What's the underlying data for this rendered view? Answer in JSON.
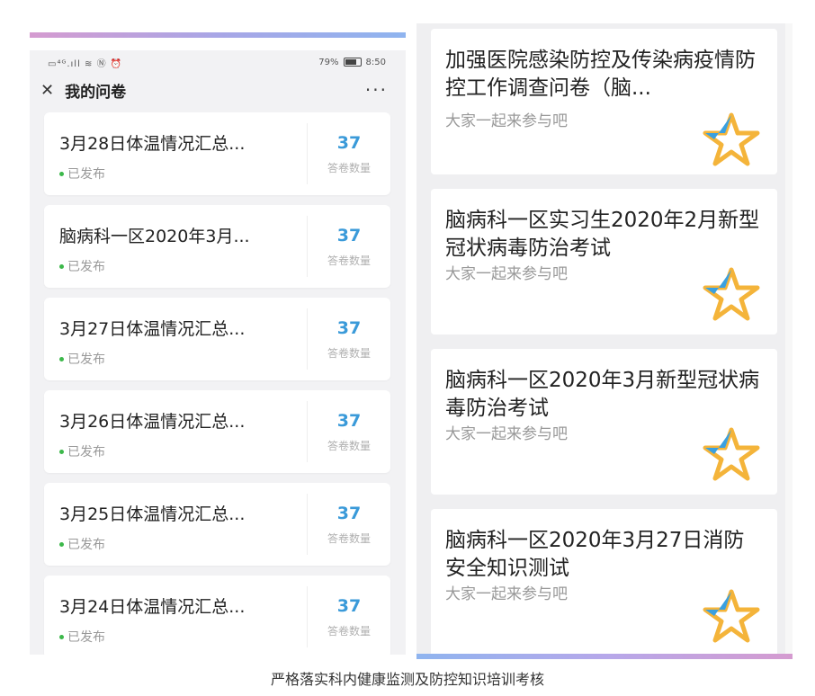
{
  "left_phone": {
    "statusbar": {
      "left_icons": "▭⁴ᴳ.ıll ≋ Ⓝ ⏰",
      "battery": "79%",
      "time": "8:50"
    },
    "title": "我的问卷",
    "more_label": "···",
    "cards": [
      {
        "title": "3月28日体温情况汇总...",
        "status": "已发布",
        "count": "37",
        "count_label": "答卷数量"
      },
      {
        "title": "脑病科一区2020年3月...",
        "status": "已发布",
        "count": "37",
        "count_label": "答卷数量"
      },
      {
        "title": "3月27日体温情况汇总...",
        "status": "已发布",
        "count": "37",
        "count_label": "答卷数量"
      },
      {
        "title": "3月26日体温情况汇总...",
        "status": "已发布",
        "count": "37",
        "count_label": "答卷数量"
      },
      {
        "title": "3月25日体温情况汇总...",
        "status": "已发布",
        "count": "37",
        "count_label": "答卷数量"
      },
      {
        "title": "3月24日体温情况汇总...",
        "status": "已发布",
        "count": "37",
        "count_label": "答卷数量"
      }
    ]
  },
  "right_phone": {
    "cards": [
      {
        "title": "加强医院感染防控及传染病疫情防控工作调查问卷（脑...",
        "subtitle": "大家一起来参与吧"
      },
      {
        "title": "脑病科一区实习生2020年2月新型冠状病毒防治考试",
        "subtitle": "大家一起来参与吧"
      },
      {
        "title": "脑病科一区2020年3月新型冠状病毒防治考试",
        "subtitle": "大家一起来参与吧"
      },
      {
        "title": "脑病科一区2020年3月27日消防安全知识测试",
        "subtitle": "大家一起来参与吧"
      }
    ]
  },
  "caption": "严格落实科内健康监测及防控知识培训考核",
  "colors": {
    "count_blue": "#3a9ad9",
    "published_green": "#3cb84a",
    "star_gold": "#f4b43a",
    "star_blue": "#3aa0e0"
  }
}
